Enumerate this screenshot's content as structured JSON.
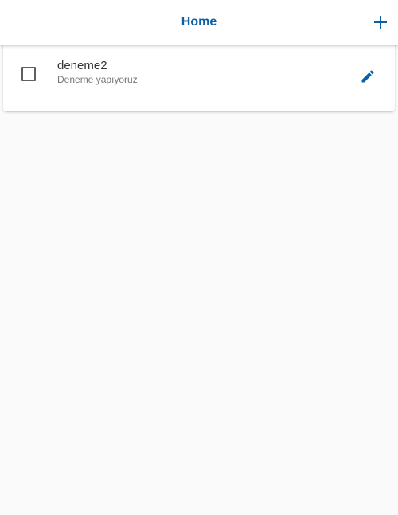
{
  "header": {
    "title": "Home",
    "add_icon": "plus-icon",
    "accent_color": "#0b5fa5"
  },
  "todo_items": [
    {
      "title": "deneme2",
      "subtitle": "Deneme yapıyoruz",
      "checked": false,
      "edit_icon": "pencil-icon"
    }
  ],
  "background_color": "#fafafa"
}
